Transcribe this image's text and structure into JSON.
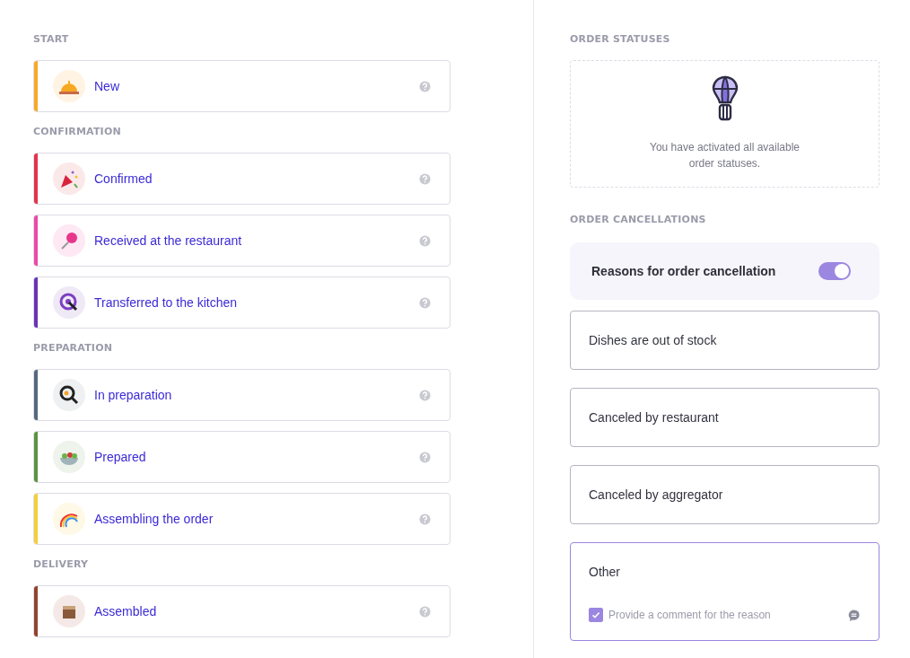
{
  "status_groups": [
    {
      "title": "START",
      "items": [
        {
          "label": "New",
          "color": "#f7a928"
        }
      ]
    },
    {
      "title": "CONFIRMATION",
      "items": [
        {
          "label": "Confirmed",
          "color": "#e2344b"
        },
        {
          "label": "Received at the restaurant",
          "color": "#ec4aa7"
        },
        {
          "label": "Transferred to the kitchen",
          "color": "#6a34b5"
        }
      ]
    },
    {
      "title": "PREPARATION",
      "items": [
        {
          "label": "In preparation",
          "color": "#55697e"
        },
        {
          "label": "Prepared",
          "color": "#5b9440"
        },
        {
          "label": "Assembling the order",
          "color": "#f4cf3c"
        }
      ]
    },
    {
      "title": "DELIVERY",
      "items": [
        {
          "label": "Assembled",
          "color": "#93432e"
        }
      ]
    }
  ],
  "order_statuses": {
    "title": "ORDER STATUSES",
    "message": "You have activated all available order statuses."
  },
  "order_cancellations": {
    "title": "ORDER CANCELLATIONS",
    "toggle": {
      "label": "Reasons for order cancellation",
      "on": true
    },
    "reasons": [
      {
        "label": "Dishes are out of stock",
        "selected": false
      },
      {
        "label": "Canceled by restaurant",
        "selected": false
      },
      {
        "label": "Canceled by aggregator",
        "selected": false
      },
      {
        "label": "Other",
        "selected": true,
        "comment": {
          "label": "Provide a comment for the reason",
          "checked": true
        }
      }
    ]
  }
}
